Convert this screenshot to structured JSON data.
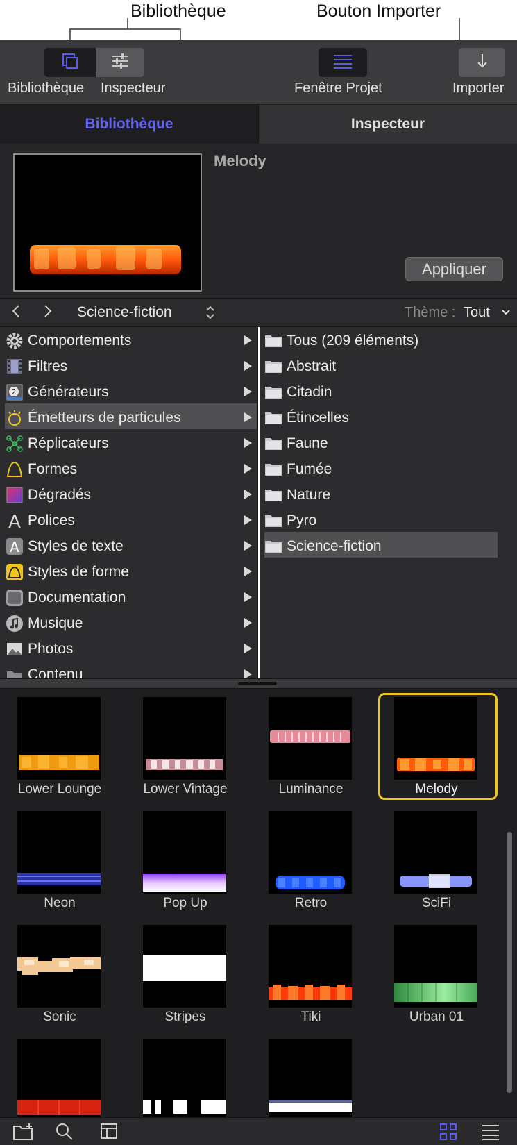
{
  "callouts": {
    "library": "Bibliothèque",
    "import": "Bouton Importer"
  },
  "toolbar": {
    "library_label": "Bibliothèque",
    "inspector_label": "Inspecteur",
    "project_label": "Fenêtre Projet",
    "import_label": "Importer"
  },
  "tabs": {
    "library": "Bibliothèque",
    "inspector": "Inspecteur"
  },
  "preview": {
    "title": "Melody",
    "apply_label": "Appliquer"
  },
  "nav": {
    "back": "<",
    "forward": ">",
    "location": "Science-fiction",
    "theme_label": "Thème :",
    "theme_value": "Tout"
  },
  "categories": [
    {
      "label": "Comportements",
      "icon": "gear-icon"
    },
    {
      "label": "Filtres",
      "icon": "film-filter-icon"
    },
    {
      "label": "Générateurs",
      "icon": "generator-icon"
    },
    {
      "label": "Émetteurs de particules",
      "icon": "particle-emitter-icon",
      "selected": true
    },
    {
      "label": "Réplicateurs",
      "icon": "replicator-icon"
    },
    {
      "label": "Formes",
      "icon": "shape-icon"
    },
    {
      "label": "Dégradés",
      "icon": "gradient-icon"
    },
    {
      "label": "Polices",
      "icon": "font-icon"
    },
    {
      "label": "Styles de texte",
      "icon": "text-style-icon"
    },
    {
      "label": "Styles de forme",
      "icon": "shape-style-icon"
    },
    {
      "label": "Documentation",
      "icon": "documentation-icon"
    },
    {
      "label": "Musique",
      "icon": "music-icon"
    },
    {
      "label": "Photos",
      "icon": "photos-icon"
    },
    {
      "label": "Contenu",
      "icon": "content-icon"
    }
  ],
  "folders": [
    {
      "label": "Tous (209 éléments)"
    },
    {
      "label": "Abstrait"
    },
    {
      "label": "Citadin"
    },
    {
      "label": "Étincelles"
    },
    {
      "label": "Faune"
    },
    {
      "label": "Fumée"
    },
    {
      "label": "Nature"
    },
    {
      "label": "Pyro"
    },
    {
      "label": "Science-fiction",
      "selected": true
    }
  ],
  "items": [
    {
      "label": "Lower Lounge"
    },
    {
      "label": "Lower Vintage"
    },
    {
      "label": "Luminance"
    },
    {
      "label": "Melody",
      "selected": true
    },
    {
      "label": "Neon"
    },
    {
      "label": "Pop Up"
    },
    {
      "label": "Retro"
    },
    {
      "label": "SciFi"
    },
    {
      "label": "Sonic"
    },
    {
      "label": "Stripes"
    },
    {
      "label": "Tiki"
    },
    {
      "label": "Urban 01"
    },
    {
      "label": ""
    },
    {
      "label": ""
    },
    {
      "label": ""
    }
  ],
  "colors": {
    "accent": "#5b5bf0",
    "selection": "#f0c419"
  }
}
